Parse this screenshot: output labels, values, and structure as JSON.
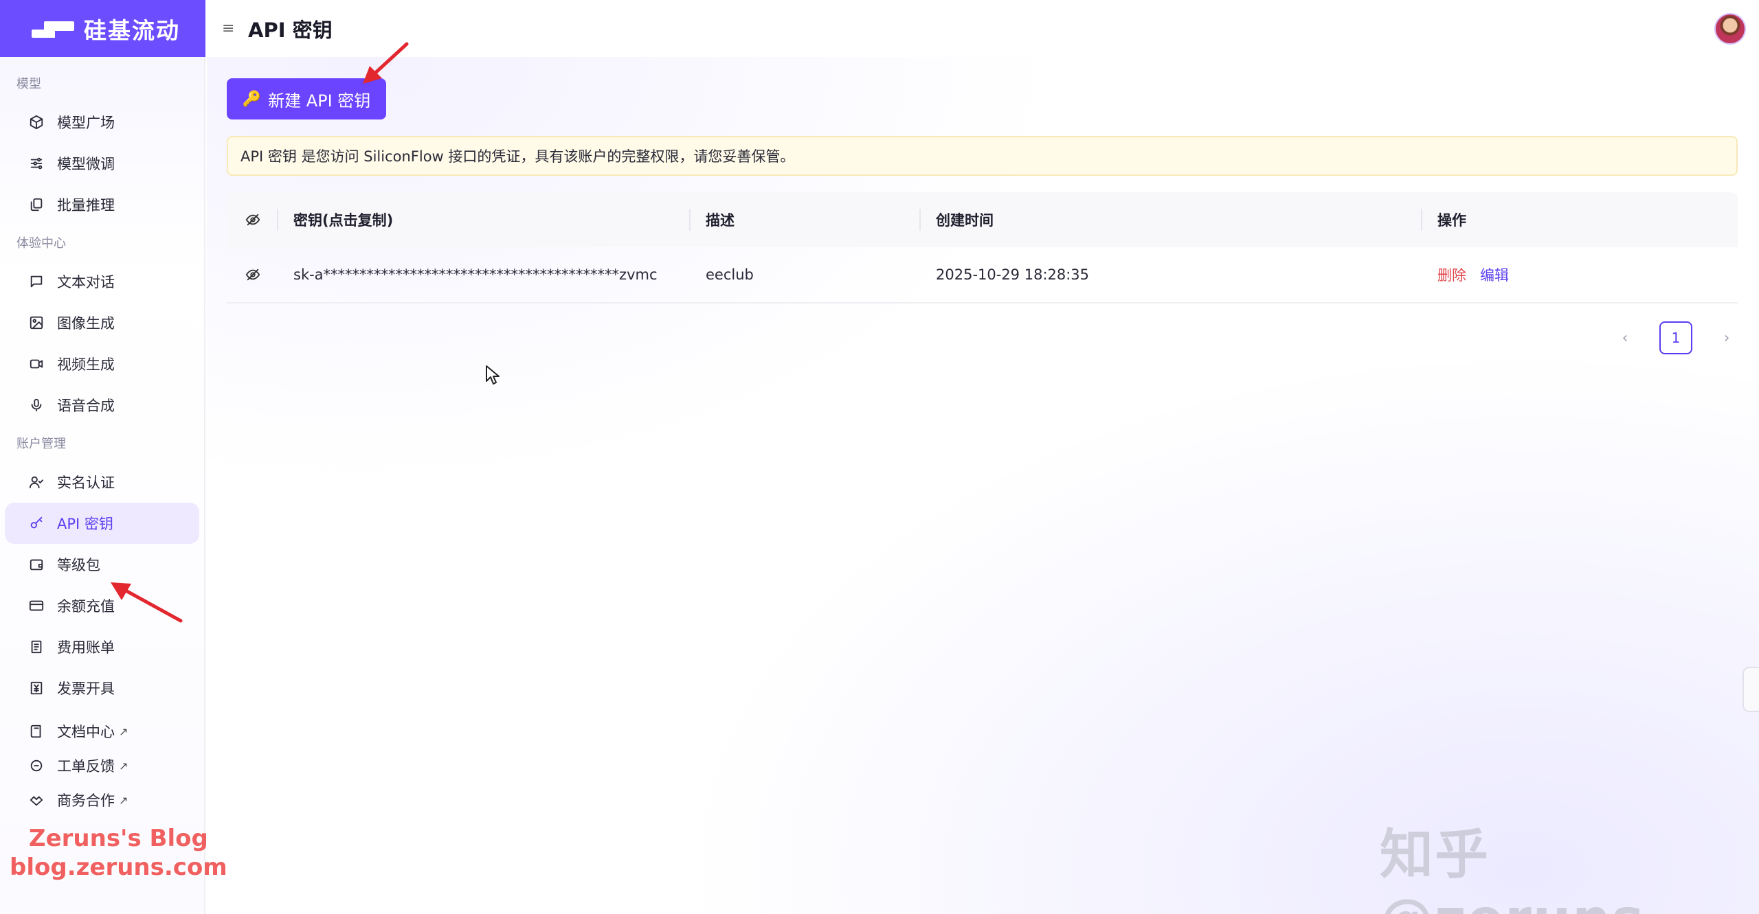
{
  "brand": {
    "name": "硅基流动"
  },
  "header": {
    "title": "API 密钥"
  },
  "sidebar": {
    "sections": [
      {
        "label": "模型",
        "items": [
          {
            "label": "模型广场",
            "icon": "cube-icon"
          },
          {
            "label": "模型微调",
            "icon": "sliders-icon"
          },
          {
            "label": "批量推理",
            "icon": "copy-icon"
          }
        ]
      },
      {
        "label": "体验中心",
        "items": [
          {
            "label": "文本对话",
            "icon": "chat-icon"
          },
          {
            "label": "图像生成",
            "icon": "image-icon"
          },
          {
            "label": "视频生成",
            "icon": "video-icon"
          },
          {
            "label": "语音合成",
            "icon": "mic-icon"
          }
        ]
      },
      {
        "label": "账户管理",
        "items": [
          {
            "label": "实名认证",
            "icon": "user-check-icon"
          },
          {
            "label": "API 密钥",
            "icon": "key-icon",
            "active": true
          },
          {
            "label": "等级包",
            "icon": "wallet-icon"
          },
          {
            "label": "余额充值",
            "icon": "credit-card-icon"
          },
          {
            "label": "费用账单",
            "icon": "receipt-icon"
          },
          {
            "label": "发票开具",
            "icon": "yen-icon"
          }
        ]
      }
    ],
    "links": [
      {
        "label": "文档中心",
        "icon": "book-icon",
        "external": "↗"
      },
      {
        "label": "工单反馈",
        "icon": "ticket-icon",
        "external": "↗"
      },
      {
        "label": "商务合作",
        "icon": "handshake-icon",
        "external": "↗"
      }
    ]
  },
  "main": {
    "new_key_label": "新建 API 密钥",
    "notice": "API 密钥 是您访问 SiliconFlow 接口的凭证，具有该账户的完整权限，请您妥善保管。",
    "table": {
      "columns": [
        "密钥(点击复制)",
        "描述",
        "创建时间",
        "操作"
      ],
      "rows": [
        {
          "key": "sk-a*****************************************zvmc",
          "description": "eeclub",
          "created": "2025-10-29 18:28:35",
          "actions": [
            "删除",
            "编辑"
          ]
        }
      ]
    },
    "pagination": {
      "current": "1",
      "prev": "‹",
      "next": "›"
    }
  },
  "watermarks": {
    "blog_line1": "Zeruns's Blog",
    "blog_line2": "blog.zeruns.com",
    "zhihu": "知乎 @zeruns"
  },
  "colors": {
    "accent": "#6a44ff",
    "danger": "#e0434a",
    "notice_bg": "#fffbe8"
  }
}
